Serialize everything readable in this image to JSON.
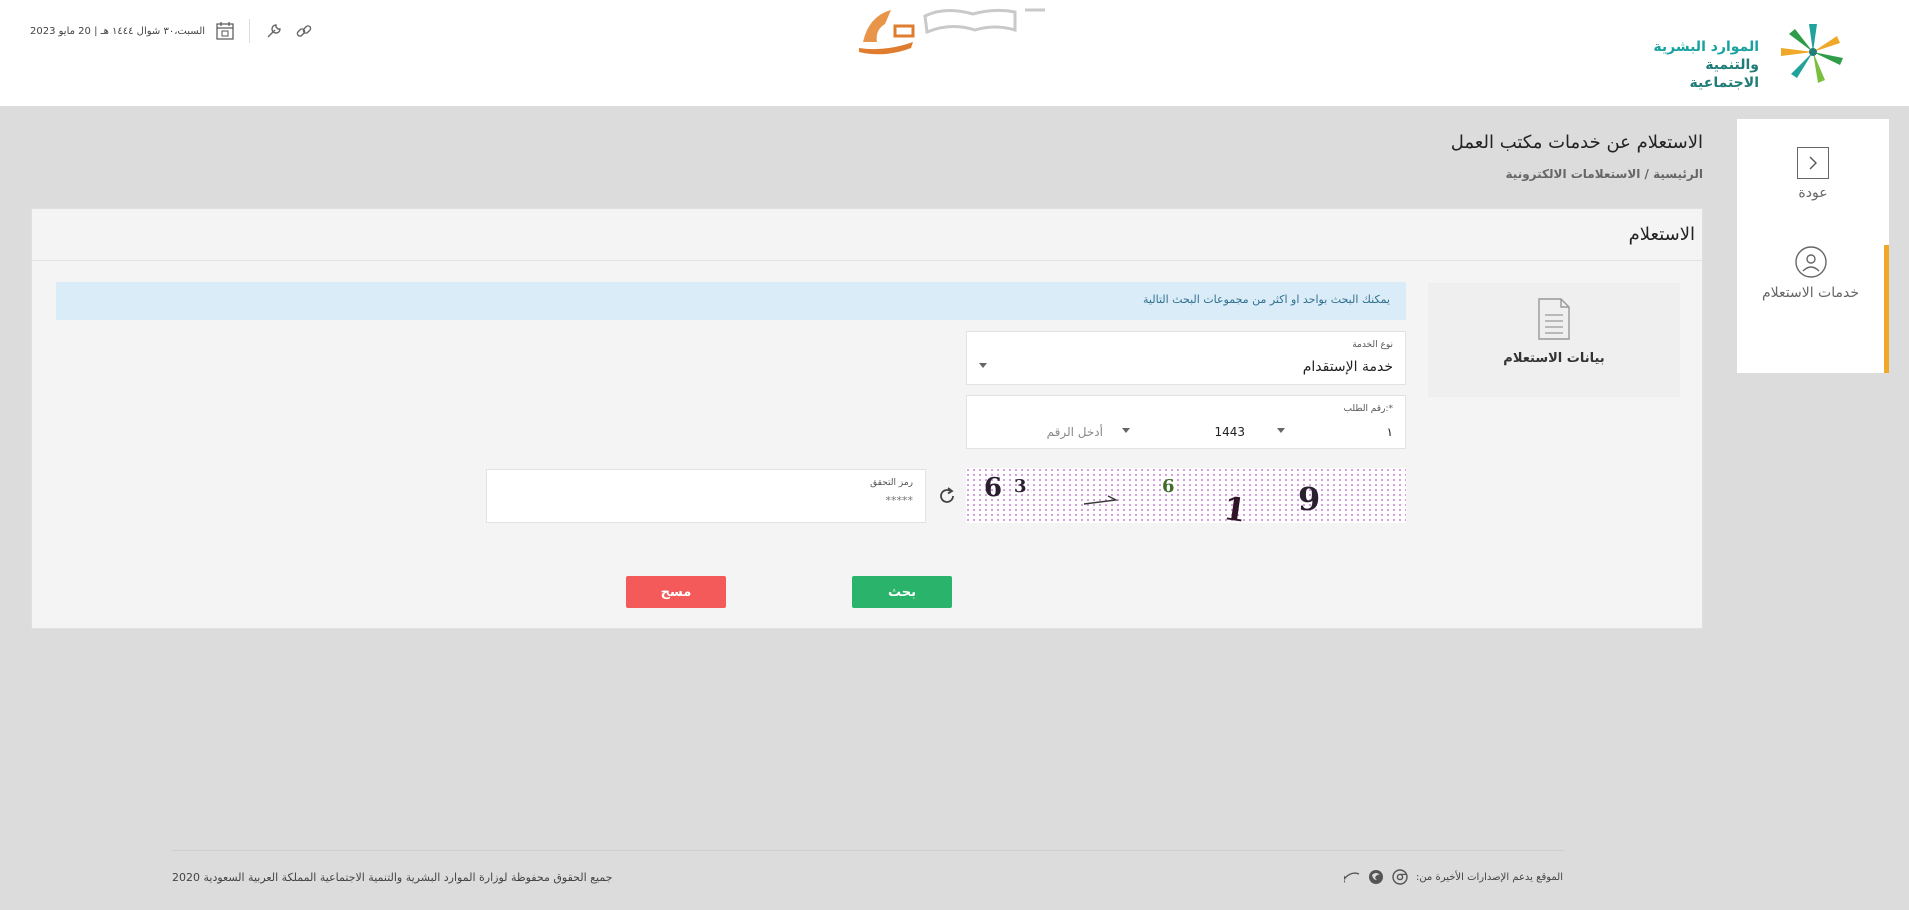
{
  "header": {
    "brand_line1": "الموارد البشرية",
    "brand_line2": "والتنمية الاجتماعية",
    "date": "السبت،٣٠ شوال ١٤٤٤ هـ | 20 مايو 2023"
  },
  "colors": {
    "accent_orange": "#f0a828",
    "search_green": "#2ab36a",
    "clear_red": "#f55a5a",
    "info_bg": "#d9ecf8",
    "brand_teal": "#17a2a0"
  },
  "sidebar": {
    "back_label": "عودة",
    "services_label": "خدمات الاستعلام"
  },
  "page": {
    "title": "الاستعلام عن خدمات مكتب العمل",
    "breadcrumb_home": "الرئيسية",
    "breadcrumb_sep": " / ",
    "breadcrumb_current": "الاستعلامات الالكترونية"
  },
  "panel": {
    "title": "الاستعلام",
    "data_card_label": "بيانات الاستعلام",
    "info_message": "يمكنك البحث بواحد او اكثر من مجموعات البحث التالية",
    "service_type_label": "نوع الخدمة",
    "service_type_value": "خدمة الإستقدام",
    "request_no_label": "رقم الطلب:*",
    "request_no_part1": "١",
    "request_no_part2": "1443",
    "request_no_placeholder": "أدخل الرقم",
    "verify_label": "رمز التحقق",
    "verify_placeholder": "*****",
    "search_button": "بحث",
    "clear_button": "مسح"
  },
  "footer": {
    "copyright": "جميع الحقوق محفوظة لوزارة الموارد البشرية والتنمية الاجتماعية المملكة العربية السعودية 2020",
    "support_text": "الموقع يدعم الإصدارات الأخيرة من:"
  }
}
